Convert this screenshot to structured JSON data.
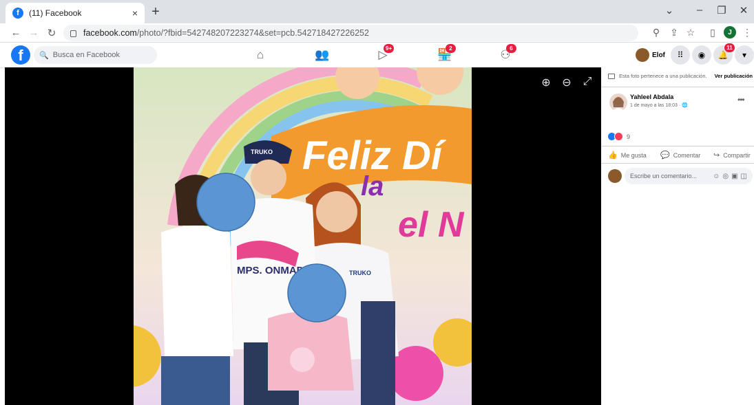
{
  "browser": {
    "tab_title": "(11) Facebook",
    "tab_close": "×",
    "new_tab": "+",
    "url_host": "facebook.com",
    "url_path": "/photo/?fbid=542748207223274&set=pcb.542718427226252",
    "profile_initial": "J"
  },
  "facebook": {
    "search_placeholder": "Busca en Facebook",
    "nav": [
      {
        "name": "home",
        "badge": ""
      },
      {
        "name": "friends",
        "badge": ""
      },
      {
        "name": "watch",
        "badge": "9+"
      },
      {
        "name": "marketplace",
        "badge": "2"
      },
      {
        "name": "groups",
        "badge": "6"
      }
    ],
    "profile_name": "Elof",
    "notifications_badge": "11"
  },
  "side_panel": {
    "publication_note": "Esta foto pertenece a una publicación.",
    "view_publication": "Ver publicación",
    "author": "Yahleel Abdala",
    "date": "1 de mayo a las 18:03 ·",
    "reaction_count": "9",
    "like_label": "Me gusta",
    "comment_label": "Comentar",
    "share_label": "Compartir",
    "comment_placeholder": "Escribe un comentario..."
  },
  "photo": {
    "banner_text_1": "Feliz Dí",
    "banner_text_2": "la",
    "banner_text_3": "el N",
    "cap_text": "TRUKO",
    "shirt_logo": "TRUKO",
    "shirt_text": "MPS. ONMADRE"
  },
  "colors": {
    "facebook_blue": "#1877f2",
    "badge_red": "#e41e3f"
  }
}
